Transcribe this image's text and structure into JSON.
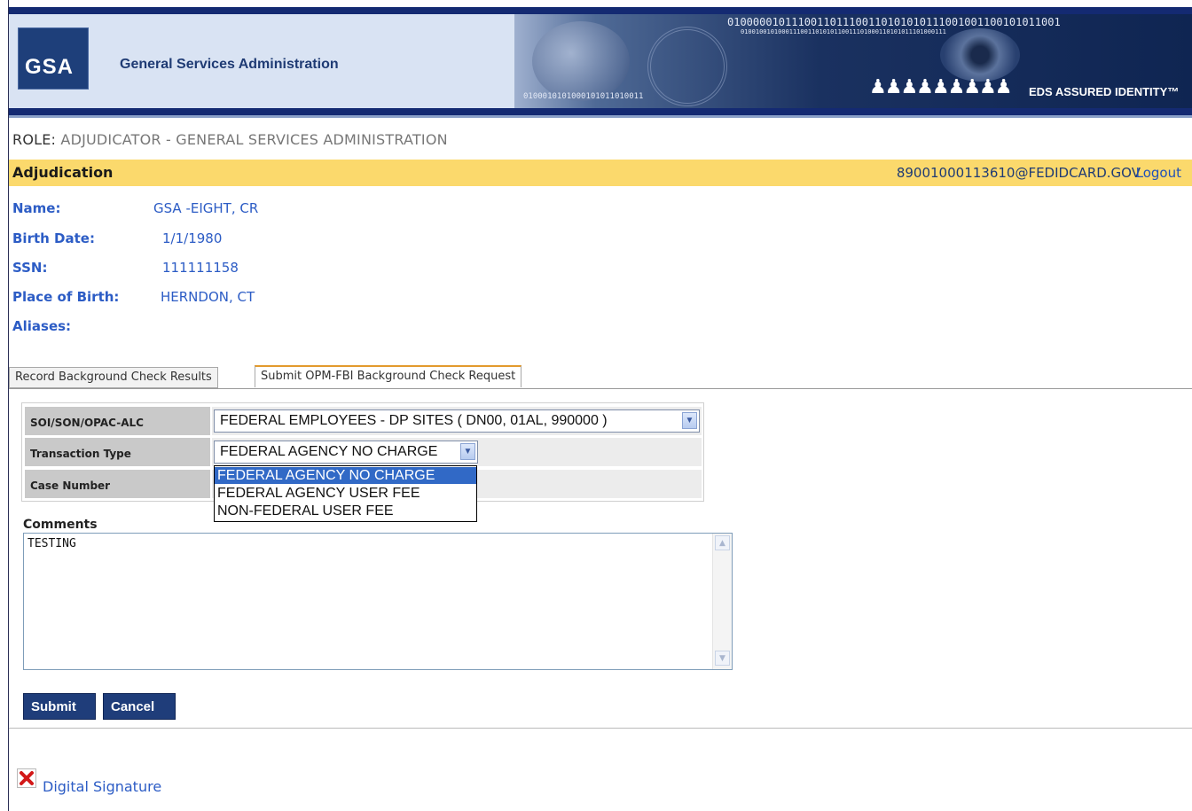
{
  "banner": {
    "logo_text": "GSA",
    "agency_name": "General Services Administration",
    "brand_tagline": "EDS ASSURED IDENTITY™",
    "binary_top": "0100000101110011011100110101010111001001100101011001",
    "binary_small": "0100100101000111001101010110011101000110101011101000111",
    "binary_left": "0100010101000101011010011"
  },
  "role": {
    "prefix": "ROLE:",
    "value": "ADJUDICATOR -  GENERAL SERVICES ADMINISTRATION"
  },
  "header": {
    "section_title": "Adjudication",
    "user_email": "89001000113610@FEDIDCARD.GOV",
    "logout_label": "Logout"
  },
  "person": {
    "name_label": "Name:",
    "name_value": "GSA -EIGHT, CR",
    "birth_label": "Birth Date:",
    "birth_value": "1/1/1980",
    "ssn_label": "SSN:",
    "ssn_value": "111111158",
    "pob_label": "Place of Birth:",
    "pob_value": "HERNDON, CT",
    "aliases_label": "Aliases:"
  },
  "tabs": [
    {
      "label": "Record Background Check Results",
      "active": false
    },
    {
      "label": "Submit OPM-FBI Background Check Request",
      "active": true
    }
  ],
  "form": {
    "soi_label": "SOI/SON/OPAC-ALC",
    "soi_value": "FEDERAL EMPLOYEES - DP SITES ( DN00, 01AL, 990000 )",
    "transaction_label": "Transaction Type",
    "transaction_value": "FEDERAL AGENCY NO CHARGE",
    "case_label": "Case Number",
    "transaction_options": [
      "FEDERAL AGENCY NO CHARGE",
      "FEDERAL AGENCY USER FEE",
      "NON-FEDERAL USER FEE"
    ],
    "comments_label": "Comments",
    "comments_value": "TESTING",
    "submit_label": "Submit",
    "cancel_label": "Cancel"
  },
  "footer": {
    "signature_label": "Digital Signature"
  },
  "icons": {
    "dropdown_arrow": "chevron-down-icon",
    "broken_image": "broken-image-icon",
    "scroll_up": "scroll-up-icon",
    "scroll_down": "scroll-down-icon"
  },
  "colors": {
    "navy": "#142a72",
    "gold_bar": "#fbd96c",
    "link_blue": "#2c5cc5",
    "button_blue": "#1f3d7a",
    "dropdown_highlight": "#3169c6",
    "tab_accent": "#e39a2d"
  }
}
